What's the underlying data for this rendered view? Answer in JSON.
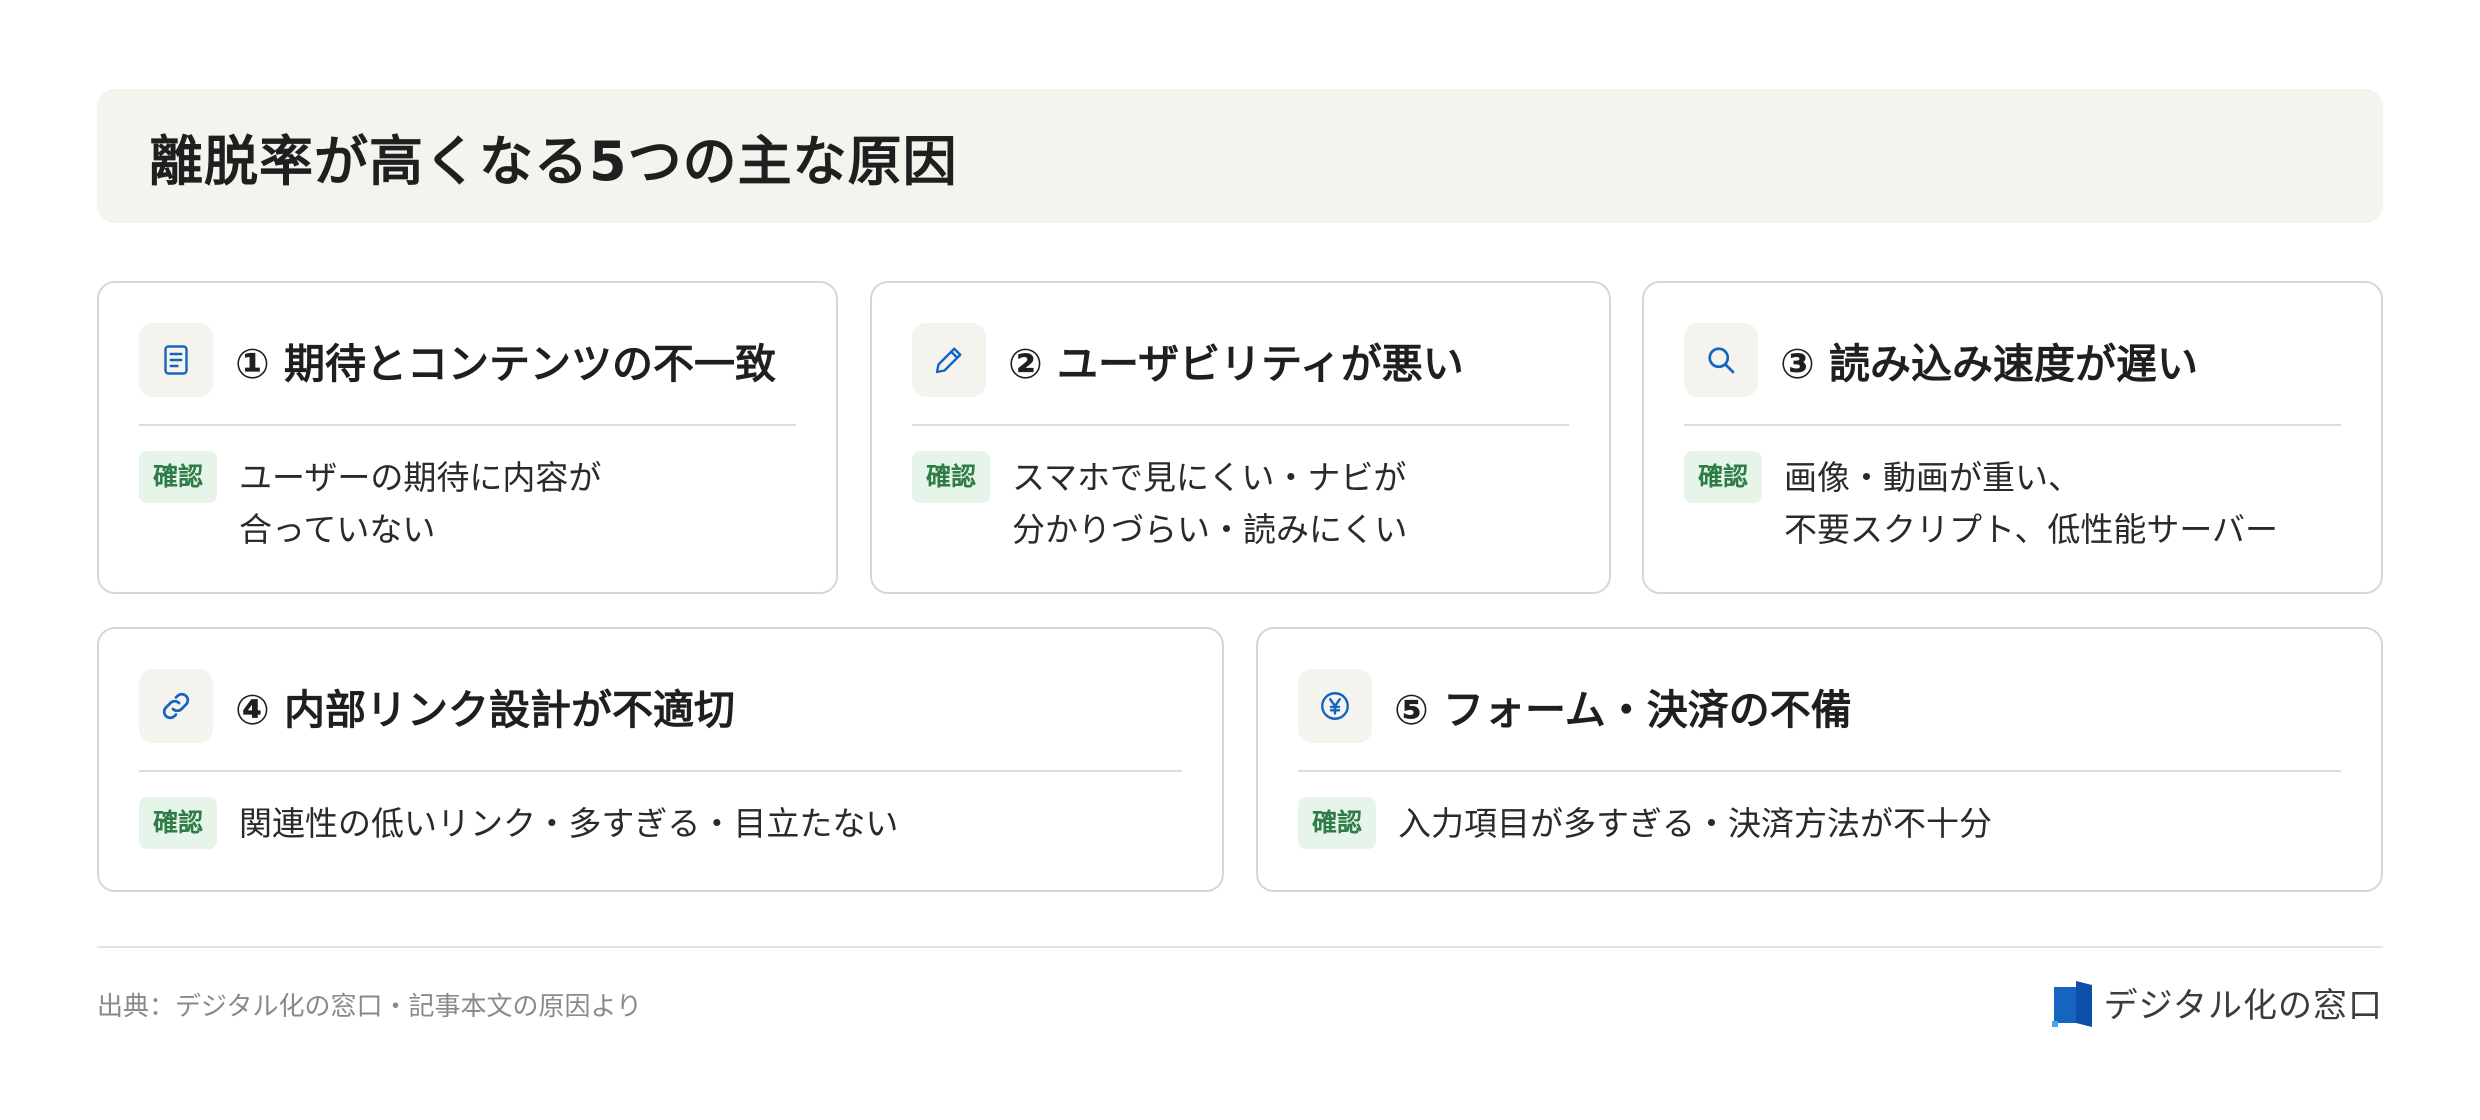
{
  "title": "離脱率が高くなる5つの主な原因",
  "badge_label": "確認",
  "colors": {
    "accent": "#1565c0",
    "badge_bg": "#e6f4ea",
    "badge_text": "#2e7d46",
    "panel_bg": "#f5f3ee"
  },
  "cards": [
    {
      "icon": "document-icon",
      "title": "① 期待とコンテンツの不一致",
      "desc": [
        "ユーザーの期待に内容が",
        "合っていない"
      ]
    },
    {
      "icon": "pencil-icon",
      "title": "② ユーザビリティが悪い",
      "desc": [
        "スマホで見にくい・ナビが",
        "分かりづらい・読みにくい"
      ]
    },
    {
      "icon": "search-icon",
      "title": "③ 読み込み速度が遅い",
      "desc": [
        "画像・動画が重い、",
        "不要スクリプト、低性能サーバー"
      ]
    },
    {
      "icon": "link-icon",
      "title": "④ 内部リンク設計が不適切",
      "desc": [
        "関連性の低いリンク・多すぎる・目立たない"
      ]
    },
    {
      "icon": "yen-icon",
      "title": "⑤ フォーム・決済の不備",
      "desc": [
        "入力項目が多すぎる・決済方法が不十分"
      ]
    }
  ],
  "footer": {
    "source": "出典：デジタル化の窓口・記事本文の原因より",
    "brand": "デジタル化の窓口"
  }
}
